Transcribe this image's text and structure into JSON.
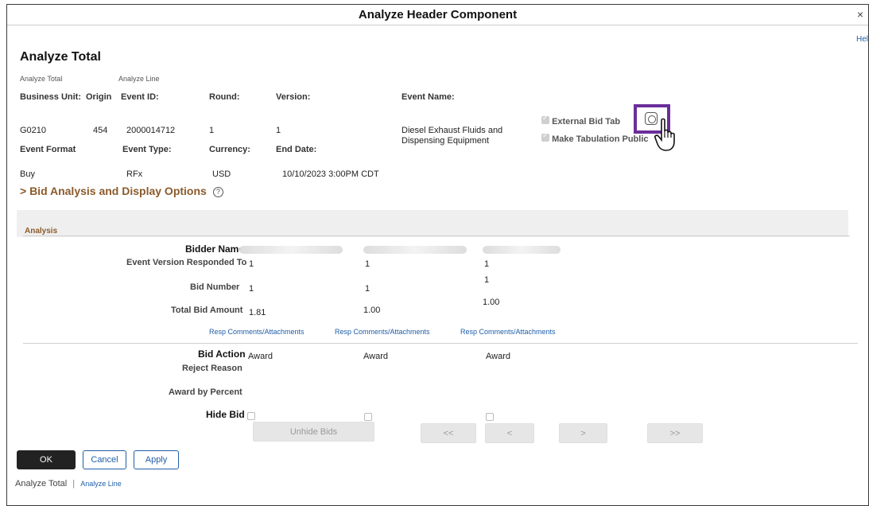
{
  "dialog": {
    "title": "Analyze Header Component",
    "close_glyph": "×",
    "help": "Hel"
  },
  "page_title": "Analyze Total",
  "subtabs": [
    "Analyze Total",
    "Analyze Line"
  ],
  "header_labels": {
    "business_unit": "Business Unit:",
    "origin": "Origin",
    "event_id": "Event ID:",
    "round": "Round:",
    "version": "Version:",
    "event_name": "Event Name:",
    "event_format": "Event Format",
    "event_type": "Event Type:",
    "currency": "Currency:",
    "end_date": "End Date:"
  },
  "header_values": {
    "business_unit": "G0210",
    "origin": "454",
    "event_id": "2000014712",
    "round": "1",
    "version": "1",
    "event_name_1": "Diesel Exhaust Fluids and",
    "event_name_2": "Dispensing Equipment",
    "event_format": "Buy",
    "event_type": "RFx",
    "currency": "USD",
    "end_date": "10/10/2023  3:00PM CDT"
  },
  "options": {
    "external_bid_tab": "External Bid Tab",
    "make_public": "Make Tabulation Public"
  },
  "section_link": "> Bid Analysis and Display Options",
  "help_icon": "?",
  "analysis": {
    "header": "Analysis",
    "labels": {
      "bidder_name": "Bidder Name",
      "event_version": "Event Version Responded To",
      "bid_number": "Bid Number",
      "total_bid_amount": "Total Bid Amount",
      "bid_action": "Bid Action",
      "reject_reason": "Reject Reason",
      "award_by_percent": "Award by Percent",
      "hide_bid": "Hide Bid"
    },
    "bidders": [
      {
        "name": "",
        "version": "1",
        "bid_number": "1",
        "total": "1.81",
        "comments": "Resp Comments/Attachments",
        "action": "Award"
      },
      {
        "name": "",
        "version": "1",
        "bid_number": "1",
        "total": "1.00",
        "comments": "Resp Comments/Attachments",
        "action": "Award"
      },
      {
        "name": "",
        "version": "1",
        "bid_number": "1",
        "total": "1.00",
        "comments": "Resp Comments/Attachments",
        "action": "Award"
      }
    ]
  },
  "buttons": {
    "unhide": "Unhide Bids",
    "first": "<<",
    "prev": "<",
    "next": ">",
    "last": ">>",
    "ok": "OK",
    "cancel": "Cancel",
    "apply": "Apply"
  },
  "footer": {
    "current": "Analyze Total",
    "separator": "|",
    "link": "Analyze Line"
  },
  "colors": {
    "accent_purple": "#6b2e9a",
    "section_brown": "#8a5a2b",
    "link_blue": "#1f5ea8"
  }
}
